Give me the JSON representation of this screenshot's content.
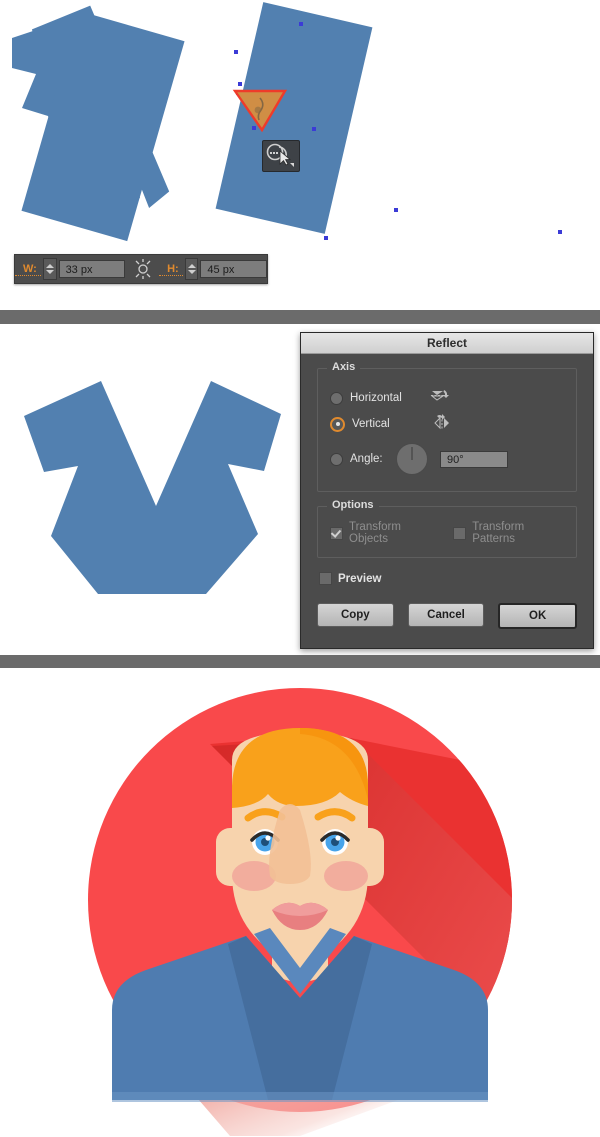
{
  "colors": {
    "shape_blue": "#5280b0",
    "shirt_blue": "#4f7cb0",
    "shirt_blue_dark": "#456e9e",
    "accent_orange": "#e08a2e",
    "selection_red": "#ef3b2a",
    "selection_fill": "#d08e45",
    "anchor_blue": "#3b3bd6",
    "avatar_bg_red": "#f9494b",
    "avatar_bg_red_dark": "#e32b2e",
    "hair_orange": "#f9a11b",
    "skin": "#f7d3ad",
    "skin_shadow": "#efbf95",
    "cheek": "#f1a69a",
    "lips": "#e87f80",
    "eye_blue": "#48a4ea",
    "panel_divider": "#6b6b6b",
    "dialog_bg": "#4b4b4b",
    "toolbar_bg": "#4c4c4c"
  },
  "transform_toolbar": {
    "width_label": "W:",
    "width_value": "33 px",
    "height_label": "H:",
    "height_value": "45 px",
    "link_icon": "constrain-proportions-icon",
    "stepper_up_icon": "stepper-up-icon",
    "stepper_down_icon": "stepper-down-icon"
  },
  "canvas_top": {
    "tool_cursor_icon": "shape-builder-cursor-icon",
    "selected_shape": "selected-triangle",
    "shapes": [
      "rotated-rectangle-left",
      "rotated-rectangle-middle",
      "notched-rectangle-right"
    ]
  },
  "reflect_dialog": {
    "title": "Reflect",
    "axis_group": {
      "legend": "Axis",
      "options": [
        {
          "label": "Horizontal",
          "selected": false,
          "icon": "reflect-horizontal-icon"
        },
        {
          "label": "Vertical",
          "selected": true,
          "icon": "reflect-vertical-icon"
        }
      ],
      "angle": {
        "label": "Angle:",
        "selected": false,
        "value": "90°",
        "dial_icon": "angle-dial-icon"
      }
    },
    "options_group": {
      "legend": "Options",
      "checkboxes": [
        {
          "label": "Transform Objects",
          "checked": true,
          "enabled": false
        },
        {
          "label": "Transform Patterns",
          "checked": false,
          "enabled": false
        }
      ]
    },
    "preview": {
      "label": "Preview",
      "checked": false
    },
    "buttons": [
      {
        "label": "Copy",
        "default": false
      },
      {
        "label": "Cancel",
        "default": false
      },
      {
        "label": "OK",
        "default": true
      }
    ]
  },
  "vshape": {
    "name": "reflected-v-shape"
  },
  "avatar": {
    "name": "flat-male-avatar-illustration",
    "parts": [
      "circle-background",
      "long-shadow",
      "hair",
      "ears",
      "face",
      "eyebrows",
      "eyes",
      "nose",
      "cheeks",
      "mouth",
      "neck",
      "shirt",
      "collar"
    ]
  }
}
